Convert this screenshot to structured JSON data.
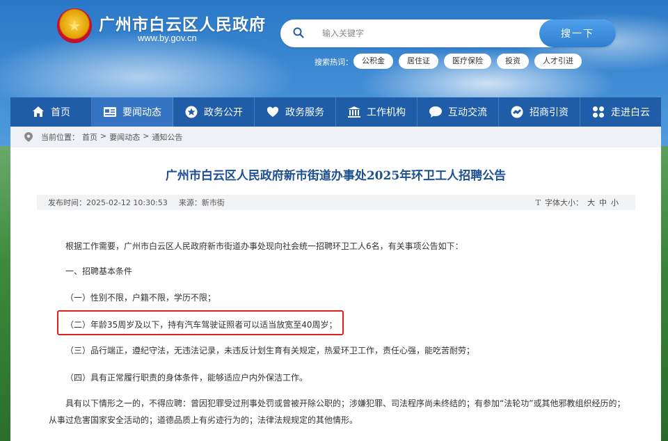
{
  "header": {
    "site_title": "广州市白云区人民政府",
    "site_url": "www.by.gov.cn",
    "search": {
      "placeholder": "输入关键字",
      "button_label": "搜一下"
    },
    "hot_label": "搜索热词：",
    "hot_tags": [
      "公积金",
      "居住证",
      "医疗保险",
      "投资",
      "人才引进"
    ]
  },
  "nav": {
    "items": [
      {
        "label": "首页",
        "icon": "home-icon"
      },
      {
        "label": "要闻动态",
        "icon": "news-icon",
        "active": true
      },
      {
        "label": "政务公开",
        "icon": "star-icon"
      },
      {
        "label": "政务服务",
        "icon": "heart-hand-icon"
      },
      {
        "label": "工作机构",
        "icon": "building-icon"
      },
      {
        "label": "互动交流",
        "icon": "chat-icon"
      },
      {
        "label": "招商引资",
        "icon": "handshake-icon"
      },
      {
        "label": "走进白云",
        "icon": "grid-icon"
      }
    ]
  },
  "breadcrumb": {
    "label": "当前位置：",
    "items": [
      "首页",
      ">",
      "要闻动态",
      ">",
      "通知公告"
    ]
  },
  "article": {
    "title": "广州市白云区人民政府新市街道办事处2025年环卫工人招聘公告",
    "publish_label": "发布时间：",
    "publish_time": "2025-02-12 10:30:53",
    "source_label": "来源：",
    "source": "新市街",
    "font_size_label": "字体大小：",
    "font_size_options": [
      "大",
      "中",
      "小"
    ],
    "paragraphs": [
      "根据工作需要，广州市白云区人民政府新市街道办事处现向社会统一招聘环卫工人6名，有关事项公告如下：",
      "一、招聘基本条件",
      "（一）性别不限，户籍不限，学历不限；",
      "（二）年龄35周岁及以下，持有汽车驾驶证照者可以适当放宽至40周岁；",
      "（三）品行端正，遵纪守法，无违法记录，未违反计划生育有关规定，热爱环卫工作，责任心强，能吃苦耐劳；",
      "（四）具有正常履行职责的身体条件，能够适应户内外保洁工作。",
      "具有以下情形之一的，不得应聘：曾因犯罪受过刑事处罚或曾被开除公职的；涉嫌犯罪、司法程序尚未终结的；有参加“法轮功”或其他邪教组织经历的；从事过危害国家安全活动的；道德品质上有劣迹行为的；法律法规规定的其他情形。"
    ]
  },
  "colors": {
    "nav_bg": "#1f5da8",
    "nav_active": "#3574c2",
    "title_color": "#1d4f91",
    "highlight_border": "#e02020"
  }
}
